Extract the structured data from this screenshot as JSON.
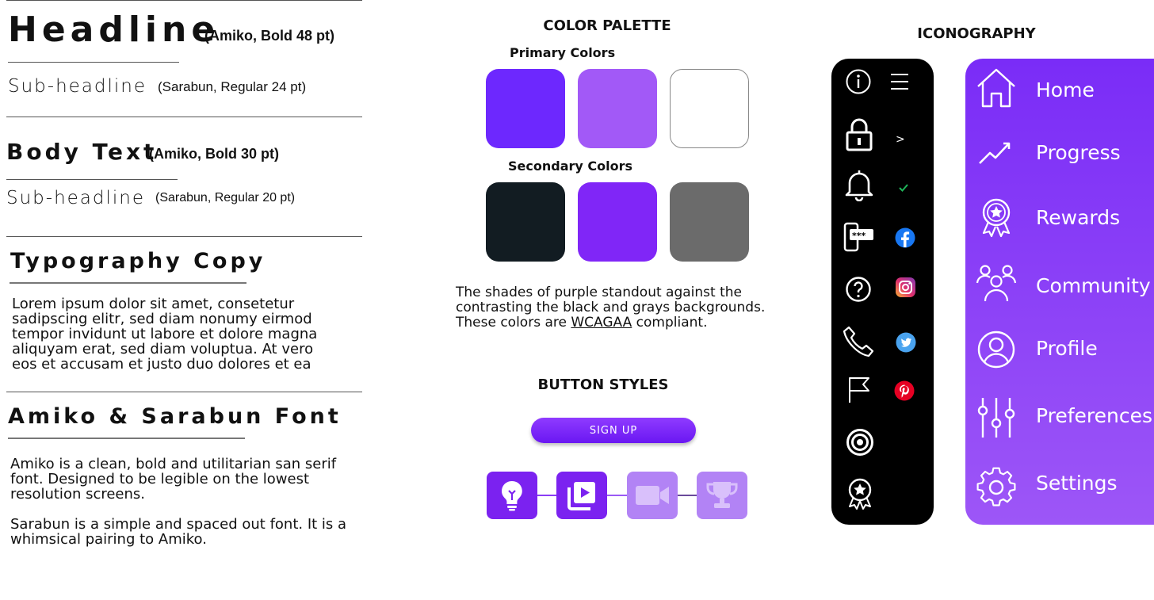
{
  "typography": {
    "headline": "Headline",
    "headline_note": "(Amiko, Bold 48 pt)",
    "subheadline_1": "Sub-headline",
    "subheadline_1_note": "(Sarabun, Regular 24 pt)",
    "body_text": "Body Text",
    "body_text_note": "(Amiko, Bold 30 pt)",
    "subheadline_2": "Sub-headline",
    "subheadline_2_note": "(Sarabun, Regular 20 pt)",
    "copy_title": "Typography Copy",
    "copy_lines": [
      "Lorem ipsum dolor sit amet, consetetur",
      "sadipscing elitr, sed diam nonumy eirmod",
      "tempor invidunt ut labore et dolore magna",
      "aliquyam erat, sed diam voluptua. At vero",
      "eos et accusam et justo duo dolores et ea"
    ],
    "font_title": "Amiko & Sarabun Font",
    "font_para1_lines": [
      "Amiko is a clean, bold and utilitarian san serif",
      "font. Designed to be legible on the lowest",
      "resolution screens."
    ],
    "font_para2_lines": [
      "Sarabun is a simple and spaced out font. It is a",
      "whimsical pairing to Amiko."
    ]
  },
  "palette": {
    "title": "COLOR PALETTE",
    "primary_label": "Primary Colors",
    "primary_colors": [
      "#6d28fe",
      "#a259f7",
      "#ffffff"
    ],
    "secondary_label": "Secondary Colors",
    "secondary_colors": [
      "#121c22",
      "#8026f7",
      "#6b6b6b"
    ],
    "description_line1": "The shades of purple standout against the",
    "description_line2": "contrasting the black and grays backgrounds.",
    "description_line3_pre": "These colors are ",
    "description_link": "WCAGAA",
    "description_line3_post": " compliant."
  },
  "buttons": {
    "title": "BUTTON STYLES",
    "signup_label": "SIGN UP",
    "steps": [
      {
        "icon": "lightbulb-icon",
        "color": "#7b22f0"
      },
      {
        "icon": "video-library-icon",
        "color": "#7b22f0"
      },
      {
        "icon": "video-camera-icon",
        "color": "#b283f5"
      },
      {
        "icon": "trophy-icon",
        "color": "#b283f5"
      }
    ]
  },
  "iconography": {
    "title": "ICONOGRAPHY",
    "black_bar_icons": [
      "info-icon",
      "menu-icon",
      "lock-icon",
      "chevron-right-icon",
      "bell-icon",
      "check-icon",
      "password-phone-icon",
      "facebook-icon",
      "help-icon",
      "instagram-icon",
      "phone-icon",
      "twitter-icon",
      "flag-icon",
      "pinterest-icon",
      "target-icon",
      "award-icon"
    ],
    "chevron_glyph": ">",
    "nav_items": [
      {
        "label": "Home",
        "icon": "home-icon"
      },
      {
        "label": "Progress",
        "icon": "trending-up-icon"
      },
      {
        "label": "Rewards",
        "icon": "rewards-icon"
      },
      {
        "label": "Community",
        "icon": "community-icon"
      },
      {
        "label": "Profile",
        "icon": "profile-icon"
      },
      {
        "label": "Preferences",
        "icon": "sliders-icon"
      },
      {
        "label": "Settings",
        "icon": "settings-icon"
      }
    ]
  }
}
